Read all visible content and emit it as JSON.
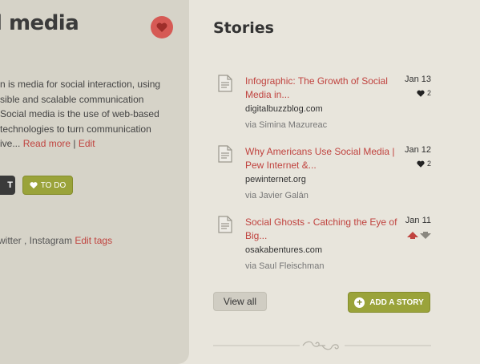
{
  "left": {
    "title": "l media",
    "subtitle": "’",
    "desc_lines": [
      "n is media for social interaction, using",
      "sible and scalable communication",
      "Social media is the use of web-based",
      "technologies to turn communication",
      "ive..."
    ],
    "read_more": "Read more",
    "separator": "|",
    "edit": "Edit",
    "dark_button_label": "T",
    "todo_label": "TO DO",
    "tags_text": "witter , Instagram",
    "edit_tags": "Edit tags"
  },
  "stories": {
    "title": "Stories",
    "items": [
      {
        "title": "Infographic: The Growth of Social Media in...",
        "domain": "digitalbuzzblog.com",
        "via": "via Simina Mazureac",
        "date": "Jan 13",
        "likes": "2"
      },
      {
        "title": "Why Americans Use Social Media | Pew Internet &...",
        "domain": "pewinternet.org",
        "via": "via Javier Galán",
        "date": "Jan 12",
        "likes": "2"
      },
      {
        "title": "Social Ghosts - Catching the Eye of Big...",
        "domain": "osakabentures.com",
        "via": "via Saul Fleischman",
        "date": "Jan 11"
      }
    ],
    "view_all": "View all",
    "add_story": "ADD A STORY"
  },
  "colors": {
    "accent_red": "#c0433f",
    "accent_green": "#9aa33a",
    "background": "#e8e5dc",
    "panel": "#d6d3c8"
  }
}
